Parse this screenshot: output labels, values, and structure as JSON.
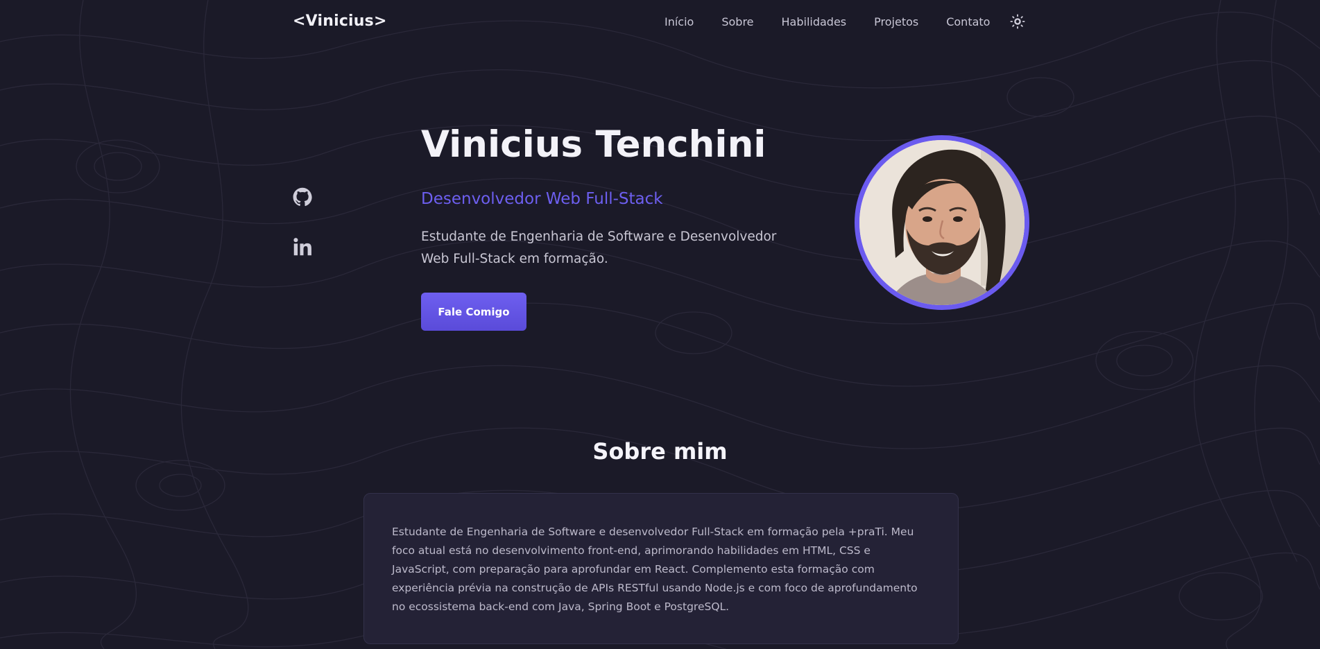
{
  "header": {
    "logo": "<Vinicius>",
    "nav": [
      "Início",
      "Sobre",
      "Habilidades",
      "Projetos",
      "Contato"
    ],
    "theme_toggle_icon": "sun-icon"
  },
  "social": {
    "github_icon": "github-icon",
    "linkedin_icon": "linkedin-icon"
  },
  "hero": {
    "name": "Vinicius Tenchini",
    "role": "Desenvolvedor Web Full-Stack",
    "description": "Estudante de Engenharia de Software e Desenvolvedor Web Full-Stack em formação.",
    "cta_label": "Fale Comigo"
  },
  "about": {
    "title": "Sobre mim",
    "text": "Estudante de Engenharia de Software e desenvolvedor Full-Stack em formação pela +praTi. Meu foco atual está no desenvolvimento front-end, aprimorando habilidades em HTML, CSS e JavaScript, com preparação para aprofundar em React. Complemento esta formação com experiência prévia na construção de APIs RESTful usando Node.js e com foco de aprofundamento no ecossistema back-end com Java, Spring Boot e PostgreSQL."
  },
  "colors": {
    "background": "#1b1a28",
    "accent": "#6b5bef",
    "card": "#242236",
    "text": "#f2f1f7",
    "muted_text": "#c9c7d4"
  }
}
